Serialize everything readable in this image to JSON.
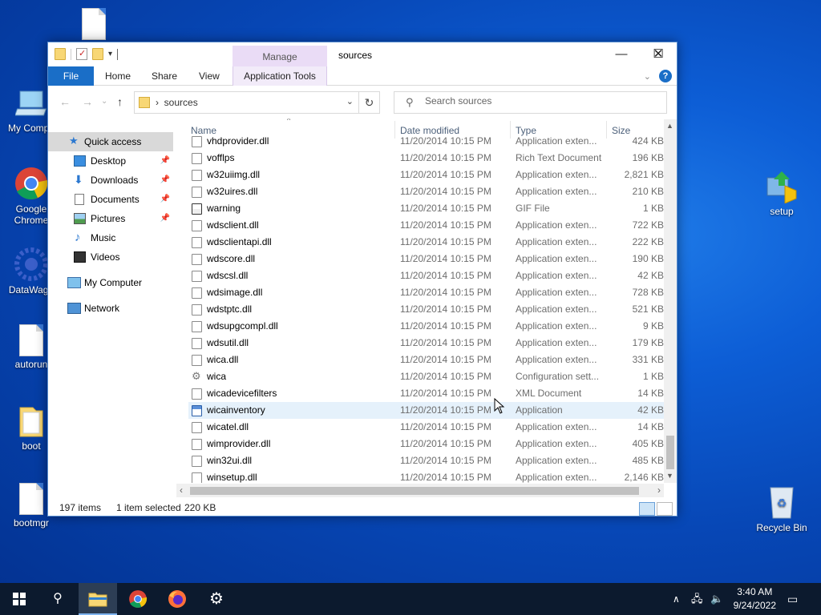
{
  "desktop": {
    "icons": [
      {
        "label": "My Compu"
      },
      {
        "label": "Google Chrome"
      },
      {
        "label": "DataWago"
      },
      {
        "label": "autorun"
      },
      {
        "label": "boot"
      },
      {
        "label": "bootmgr"
      },
      {
        "label": "setup"
      },
      {
        "label": "Recycle Bin"
      }
    ]
  },
  "window": {
    "title": "sources",
    "manage_tab": "Manage",
    "controls": {
      "minimize": "—",
      "maximize": "☐",
      "close": "✕"
    }
  },
  "ribbon": {
    "tabs": [
      "File",
      "Home",
      "Share",
      "View",
      "Application Tools"
    ]
  },
  "address": {
    "crumb": "sources",
    "search_placeholder": "Search sources"
  },
  "navpane": {
    "items": [
      {
        "label": "Quick access",
        "icon": "star-icon",
        "pinned": false,
        "selected": true
      },
      {
        "label": "Desktop",
        "icon": "desktop-icon",
        "pinned": true
      },
      {
        "label": "Downloads",
        "icon": "download-icon",
        "pinned": true
      },
      {
        "label": "Documents",
        "icon": "documents-icon",
        "pinned": true
      },
      {
        "label": "Pictures",
        "icon": "pictures-icon",
        "pinned": true
      },
      {
        "label": "Music",
        "icon": "music-icon",
        "pinned": false
      },
      {
        "label": "Videos",
        "icon": "videos-icon",
        "pinned": false
      },
      {
        "label": "My Computer",
        "icon": "computer-icon",
        "pinned": false
      },
      {
        "label": "Network",
        "icon": "network-icon",
        "pinned": false
      }
    ]
  },
  "columns": {
    "name": "Name",
    "date": "Date modified",
    "type": "Type",
    "size": "Size"
  },
  "files": [
    {
      "name": "vhdprovider.dll",
      "date": "11/20/2014 10:15 PM",
      "type": "Application exten...",
      "size": "424 KB",
      "icon": "dll"
    },
    {
      "name": "vofflps",
      "date": "11/20/2014 10:15 PM",
      "type": "Rich Text Document",
      "size": "196 KB",
      "icon": "doc"
    },
    {
      "name": "w32uiimg.dll",
      "date": "11/20/2014 10:15 PM",
      "type": "Application exten...",
      "size": "2,821 KB",
      "icon": "dll"
    },
    {
      "name": "w32uires.dll",
      "date": "11/20/2014 10:15 PM",
      "type": "Application exten...",
      "size": "210 KB",
      "icon": "dll"
    },
    {
      "name": "warning",
      "date": "11/20/2014 10:15 PM",
      "type": "GIF File",
      "size": "1 KB",
      "icon": "gif"
    },
    {
      "name": "wdsclient.dll",
      "date": "11/20/2014 10:15 PM",
      "type": "Application exten...",
      "size": "722 KB",
      "icon": "dll"
    },
    {
      "name": "wdsclientapi.dll",
      "date": "11/20/2014 10:15 PM",
      "type": "Application exten...",
      "size": "222 KB",
      "icon": "dll"
    },
    {
      "name": "wdscore.dll",
      "date": "11/20/2014 10:15 PM",
      "type": "Application exten...",
      "size": "190 KB",
      "icon": "dll"
    },
    {
      "name": "wdscsl.dll",
      "date": "11/20/2014 10:15 PM",
      "type": "Application exten...",
      "size": "42 KB",
      "icon": "dll"
    },
    {
      "name": "wdsimage.dll",
      "date": "11/20/2014 10:15 PM",
      "type": "Application exten...",
      "size": "728 KB",
      "icon": "dll"
    },
    {
      "name": "wdstptc.dll",
      "date": "11/20/2014 10:15 PM",
      "type": "Application exten...",
      "size": "521 KB",
      "icon": "dll"
    },
    {
      "name": "wdsupgcompl.dll",
      "date": "11/20/2014 10:15 PM",
      "type": "Application exten...",
      "size": "9 KB",
      "icon": "dll"
    },
    {
      "name": "wdsutil.dll",
      "date": "11/20/2014 10:15 PM",
      "type": "Application exten...",
      "size": "179 KB",
      "icon": "dll"
    },
    {
      "name": "wica.dll",
      "date": "11/20/2014 10:15 PM",
      "type": "Application exten...",
      "size": "331 KB",
      "icon": "dll"
    },
    {
      "name": "wica",
      "date": "11/20/2014 10:15 PM",
      "type": "Configuration sett...",
      "size": "1 KB",
      "icon": "gear"
    },
    {
      "name": "wicadevicefilters",
      "date": "11/20/2014 10:15 PM",
      "type": "XML Document",
      "size": "14 KB",
      "icon": "xml"
    },
    {
      "name": "wicainventory",
      "date": "11/20/2014 10:15 PM",
      "type": "Application",
      "size": "42 KB",
      "icon": "app",
      "selected": true
    },
    {
      "name": "wicatel.dll",
      "date": "11/20/2014 10:15 PM",
      "type": "Application exten...",
      "size": "14 KB",
      "icon": "dll"
    },
    {
      "name": "wimprovider.dll",
      "date": "11/20/2014 10:15 PM",
      "type": "Application exten...",
      "size": "405 KB",
      "icon": "dll"
    },
    {
      "name": "win32ui.dll",
      "date": "11/20/2014 10:15 PM",
      "type": "Application exten...",
      "size": "485 KB",
      "icon": "dll"
    },
    {
      "name": "winsetup.dll",
      "date": "11/20/2014 10:15 PM",
      "type": "Application exten...",
      "size": "2,146 KB",
      "icon": "dll"
    }
  ],
  "status": {
    "count": "197 items",
    "selection": "1 item selected",
    "selection_size": "220 KB"
  },
  "taskbar": {
    "apps": [
      "start-icon",
      "search-icon",
      "file-explorer-icon",
      "chrome-icon",
      "firefox-icon",
      "settings-icon"
    ],
    "time": "3:40 AM",
    "date": "9/24/2022"
  },
  "colors": {
    "accent": "#1a6ec7",
    "selection": "#e5f1fb",
    "manage_tab": "#eadcf6"
  }
}
